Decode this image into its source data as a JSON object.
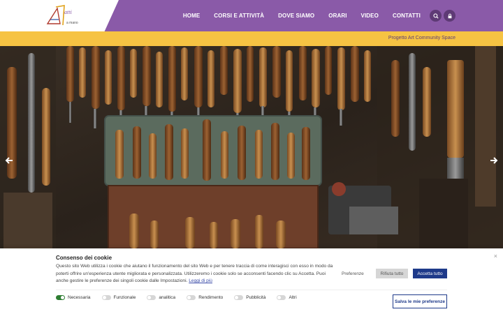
{
  "header": {
    "logo_alt": "Fatti Fatti a mano",
    "nav": [
      "HOME",
      "CORSI E ATTIVITÀ",
      "DOVE SIAMO",
      "ORARI",
      "VIDEO",
      "CONTATTI"
    ],
    "search_icon": "search-icon",
    "lock_icon": "lock-icon",
    "colors": {
      "bar": "#8a5aa8",
      "icon_bg": "#5e3a75"
    }
  },
  "strip": {
    "text": "Progetto Art Community Space",
    "color": "#f6c343"
  },
  "hero": {
    "image": "woodworking-tools-photo",
    "prev_icon": "arrow-left-icon",
    "next_icon": "arrow-right-icon"
  },
  "cookie": {
    "title": "Consenso dei cookie",
    "text": "Questo sito Web utilizza i cookie che aiutano il funzionamento del sito Web e per tenere traccia di come interagisci con esso in modo da poterti offrire un'esperienza utente migliorata e personalizzata. Utilizzeremo i cookie solo se acconsenti facendo clic su Accetta. Puoi anche gestire le preferenze dei singoli cookie dalle Impostazioni.",
    "link": "Leggi di più",
    "close": "×",
    "btn_preferences": "Preferenze",
    "btn_reject": "Rifiuta tutto",
    "btn_accept": "Accetta tutto",
    "btn_save": "Salva le mie preferenze",
    "toggles": [
      {
        "label": "Necessaria",
        "on": true
      },
      {
        "label": "Funzionale",
        "on": false
      },
      {
        "label": "analitica",
        "on": false
      },
      {
        "label": "Rendimento",
        "on": false
      },
      {
        "label": "Pubblicità",
        "on": false
      },
      {
        "label": "Altri",
        "on": false
      }
    ]
  }
}
